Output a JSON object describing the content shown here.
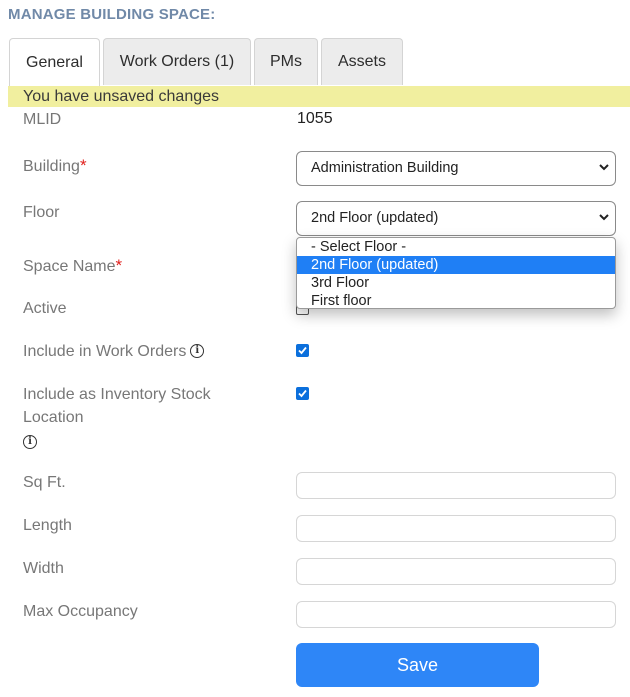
{
  "page": {
    "title": "MANAGE BUILDING SPACE:"
  },
  "tabs": [
    {
      "label": "General",
      "active": true
    },
    {
      "label": "Work Orders (1)",
      "active": false
    },
    {
      "label": "PMs",
      "active": false
    },
    {
      "label": "Assets",
      "active": false
    }
  ],
  "banner": {
    "unsaved_text": "You have unsaved changes"
  },
  "form": {
    "mlid": {
      "label": "MLID",
      "value": "1055"
    },
    "building": {
      "label": "Building",
      "required_mark": "*",
      "selected": "Administration Building"
    },
    "floor": {
      "label": "Floor",
      "selected": "2nd Floor (updated)",
      "options": [
        "- Select Floor -",
        "2nd Floor (updated)",
        "3rd Floor",
        "First floor"
      ],
      "highlighted_option": "2nd Floor (updated)"
    },
    "space_name": {
      "label": "Space Name",
      "required_mark": "*"
    },
    "active": {
      "label": "Active",
      "checked": false
    },
    "include_work_orders": {
      "label": "Include in Work Orders",
      "checked": true,
      "info_icon": "info-icon"
    },
    "include_inventory": {
      "label_line1": "Include as Inventory Stock",
      "label_line2": "Location",
      "checked": true,
      "info_icon": "info-icon"
    },
    "sq_ft": {
      "label": "Sq Ft.",
      "value": ""
    },
    "length": {
      "label": "Length",
      "value": ""
    },
    "width": {
      "label": "Width",
      "value": ""
    },
    "max_occupancy": {
      "label": "Max Occupancy",
      "value": ""
    }
  },
  "actions": {
    "save_label": "Save"
  },
  "colors": {
    "title": "#7089a8",
    "banner_bg": "#f1ef9f",
    "required": "#e0201d",
    "primary_button": "#2e86f7",
    "checkbox_on": "#0b6fdc",
    "option_highlight": "#1f7ff5"
  }
}
